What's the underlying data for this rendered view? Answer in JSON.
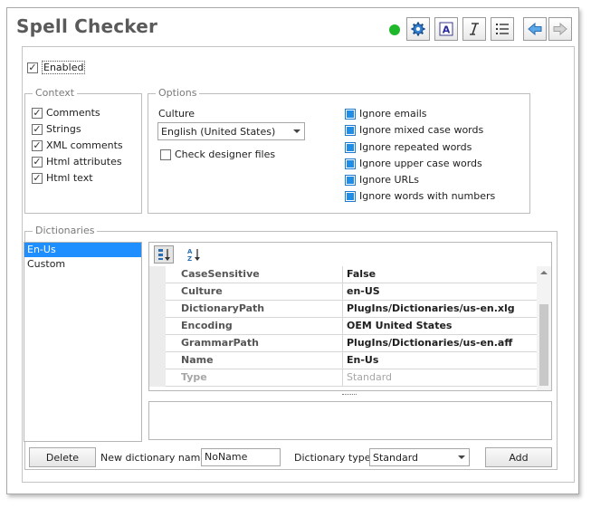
{
  "window": {
    "title": "Spell Checker"
  },
  "toolbar": {
    "buttons": [
      {
        "icon": "gear-icon"
      },
      {
        "icon": "text-format-icon"
      },
      {
        "icon": "italic-clear-icon"
      },
      {
        "icon": "list-icon"
      },
      {
        "icon": "arrow-left-icon"
      },
      {
        "icon": "arrow-right-icon"
      }
    ],
    "status_color": "#1fb82a"
  },
  "enabled": {
    "label": "Enabled",
    "checked": true
  },
  "context": {
    "title": "Context",
    "items": [
      {
        "label": "Comments",
        "checked": true
      },
      {
        "label": "Strings",
        "checked": true
      },
      {
        "label": "XML comments",
        "checked": true
      },
      {
        "label": "Html attributes",
        "checked": true
      },
      {
        "label": "Html text",
        "checked": true
      }
    ]
  },
  "options": {
    "title": "Options",
    "culture_label": "Culture",
    "culture_value": "English (United States)",
    "check_designer_label": "Check designer files",
    "check_designer_checked": false,
    "ignore": [
      {
        "label": "Ignore emails",
        "checked": true
      },
      {
        "label": "Ignore mixed case words",
        "checked": true
      },
      {
        "label": "Ignore repeated words",
        "checked": true
      },
      {
        "label": "Ignore upper case words",
        "checked": true
      },
      {
        "label": "Ignore URLs",
        "checked": true
      },
      {
        "label": "Ignore words with numbers",
        "checked": true
      }
    ]
  },
  "dictionaries": {
    "title": "Dictionaries",
    "list": [
      "En-Us",
      "Custom"
    ],
    "selected": "En-Us",
    "properties": [
      {
        "name": "CaseSensitive",
        "value": "False"
      },
      {
        "name": "Culture",
        "value": "en-US"
      },
      {
        "name": "DictionaryPath",
        "value": "PlugIns/Dictionaries/us-en.xlg"
      },
      {
        "name": "Encoding",
        "value": "OEM United States"
      },
      {
        "name": "GrammarPath",
        "value": "PlugIns/Dictionaries/us-en.aff"
      },
      {
        "name": "Name",
        "value": "En-Us"
      },
      {
        "name": "Type",
        "value": "Standard"
      }
    ]
  },
  "footer": {
    "delete_label": "Delete",
    "new_name_label": "New dictionary name:",
    "new_name_value": "NoName",
    "type_label": "Dictionary type:",
    "type_value": "Standard",
    "add_label": "Add"
  }
}
